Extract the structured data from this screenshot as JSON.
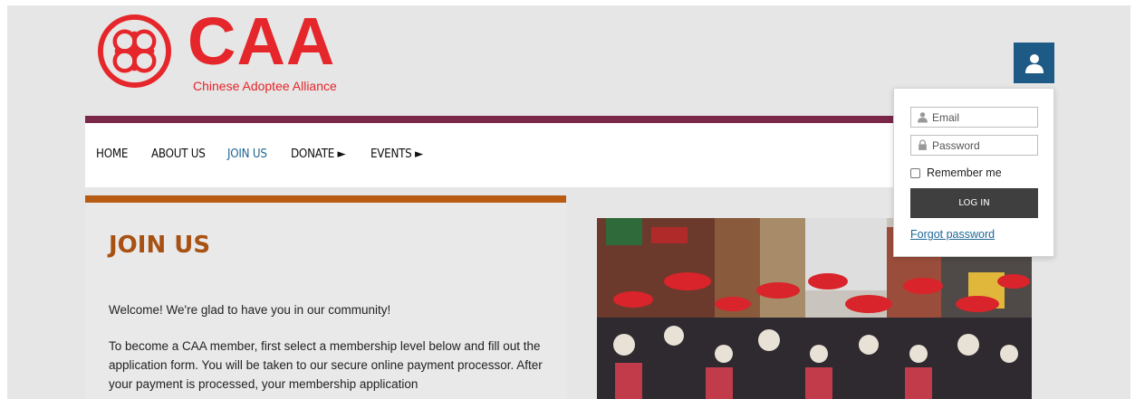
{
  "brand": {
    "name": "CAA",
    "tagline": "Chinese Adoptee Alliance",
    "color": "#e5262b"
  },
  "nav": {
    "items": [
      {
        "label": "HOME"
      },
      {
        "label": "ABOUT US"
      },
      {
        "label": "JOIN US",
        "active": true
      },
      {
        "label": "DONATE ►"
      },
      {
        "label": "EVENTS ►"
      }
    ]
  },
  "content": {
    "title": "JOIN US",
    "welcome": "Welcome! We're glad to have you in our community!",
    "intro": "To become a CAA member, first select a membership level below and fill out the application form. You will be taken to our secure online payment processor. After your payment is processed, your membership application"
  },
  "login": {
    "email_placeholder": "Email",
    "password_placeholder": "Password",
    "remember_label": "Remember me",
    "login_button": "LOG IN",
    "forgot_link": "Forgot password"
  },
  "colors": {
    "nav_accent": "#7a2749",
    "card_accent": "#b85c13",
    "title": "#a75213",
    "link": "#1d6796",
    "user_button": "#1e5a86"
  },
  "icons": {
    "user": "user-icon",
    "email": "user-icon",
    "password": "lock-icon"
  }
}
